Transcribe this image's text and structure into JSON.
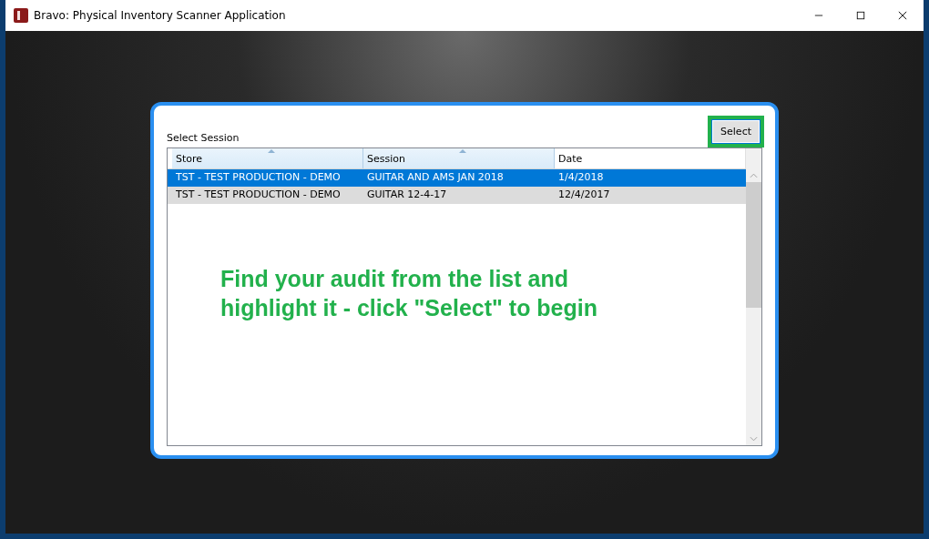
{
  "window": {
    "title": "Bravo: Physical Inventory Scanner Application"
  },
  "panel": {
    "label": "Select Session",
    "button": "Select",
    "columns": [
      {
        "label": "Store",
        "sorted": true
      },
      {
        "label": "Session",
        "sorted": true
      },
      {
        "label": "Date",
        "sorted": false
      }
    ],
    "rows": [
      {
        "cells": [
          "TST - TEST PRODUCTION - DEMO",
          "GUITAR AND AMS JAN 2018",
          "1/4/2018"
        ],
        "selected": true
      },
      {
        "cells": [
          "TST - TEST PRODUCTION - DEMO",
          "GUITAR 12-4-17",
          "12/4/2017"
        ],
        "selected": false
      }
    ],
    "instruction": "Find your audit from the list and highlight it - click \"Select\" to begin"
  }
}
